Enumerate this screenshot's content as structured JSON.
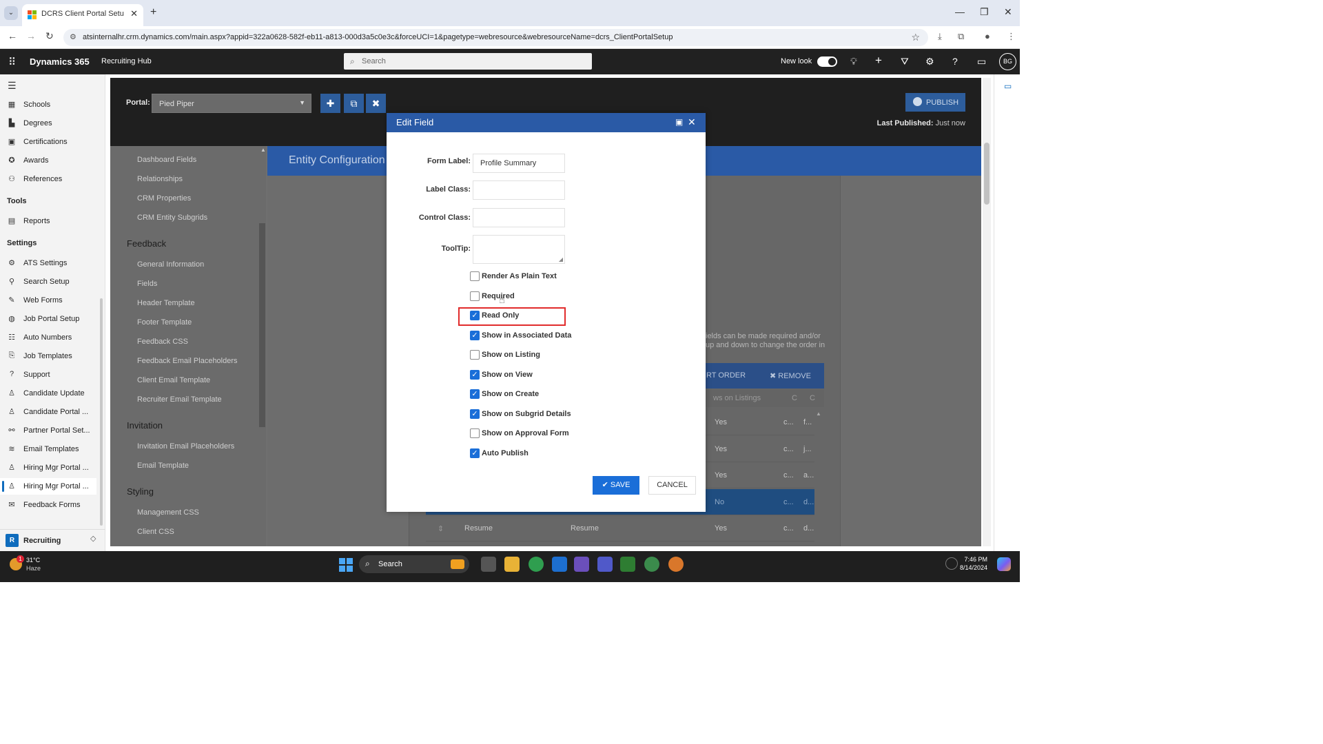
{
  "browser": {
    "tab_title": "DCRS Client Portal Setup Web",
    "url": "atsinternalhr.crm.dynamics.com/main.aspx?appid=322a0628-582f-eb11-a813-000d3a5c0e3c&forceUCI=1&pagetype=webresource&webresourceName=dcrs_ClientPortalSetup"
  },
  "header": {
    "brand": "Dynamics 365",
    "app_name": "Recruiting Hub",
    "search_placeholder": "Search",
    "new_look_label": "New look",
    "new_look_on": true,
    "avatar_initials": "BG"
  },
  "leftnav": {
    "items_top": [
      {
        "label": "Schools",
        "icon": "school-icon"
      },
      {
        "label": "Degrees",
        "icon": "degree-icon"
      },
      {
        "label": "Certifications",
        "icon": "certificate-icon"
      },
      {
        "label": "Awards",
        "icon": "award-icon"
      },
      {
        "label": "References",
        "icon": "references-icon"
      }
    ],
    "tools_heading": "Tools",
    "tools_items": [
      {
        "label": "Reports",
        "icon": "reports-icon"
      }
    ],
    "settings_heading": "Settings",
    "settings_items": [
      {
        "label": "ATS Settings",
        "icon": "gear-icon"
      },
      {
        "label": "Search Setup",
        "icon": "search-setup-icon"
      },
      {
        "label": "Web Forms",
        "icon": "web-forms-icon"
      },
      {
        "label": "Job Portal Setup",
        "icon": "globe-icon"
      },
      {
        "label": "Auto Numbers",
        "icon": "numbered-list-icon"
      },
      {
        "label": "Job Templates",
        "icon": "template-icon"
      },
      {
        "label": "Support",
        "icon": "help-icon"
      },
      {
        "label": "Candidate Update",
        "icon": "person-icon"
      },
      {
        "label": "Candidate Portal ...",
        "icon": "person-icon"
      },
      {
        "label": "Partner Portal Set...",
        "icon": "partner-icon"
      },
      {
        "label": "Email Templates",
        "icon": "stack-icon"
      },
      {
        "label": "Hiring Mgr Portal ...",
        "icon": "person-icon"
      },
      {
        "label": "Hiring Mgr Portal ...",
        "icon": "person-icon"
      },
      {
        "label": "Feedback Forms",
        "icon": "feedback-icon"
      }
    ],
    "active_index": 12,
    "area_letter": "R",
    "area_label": "Recruiting"
  },
  "portal_bar": {
    "portal_label": "Portal:",
    "portal_value": "Pied Piper",
    "publish_label": "PUBLISH",
    "last_published_label": "Last Published:",
    "last_published_value": "Just now"
  },
  "subnav": {
    "group1": [
      "Dashboard Fields",
      "Relationships",
      "CRM Properties",
      "CRM Entity Subgrids"
    ],
    "feedback_heading": "Feedback",
    "feedback_items": [
      "General Information",
      "Fields",
      "Header Template",
      "Footer Template",
      "Feedback CSS",
      "Feedback Email Placeholders",
      "Client Email Template",
      "Recruiter Email Template"
    ],
    "invitation_heading": "Invitation",
    "invitation_items": [
      "Invitation Email Placeholders",
      "Email Template"
    ],
    "styling_heading": "Styling",
    "styling_items": [
      "Management CSS",
      "Client CSS"
    ]
  },
  "content": {
    "entity_config_title": "Entity Configuration",
    "desc_line1": "ields can be made required and/or",
    "desc_line2": "up and down to change the order in",
    "sort_order_label": "RT ORDER",
    "remove_label": "REMOVE",
    "grid_headers": [
      "ws on Listings",
      "C",
      "C"
    ],
    "rows": [
      {
        "a": "",
        "b": "",
        "listing": "Yes",
        "c1": "c...",
        "c2": "f..."
      },
      {
        "a": "",
        "b": "",
        "listing": "Yes",
        "c1": "c...",
        "c2": "j..."
      },
      {
        "a": "",
        "b": "",
        "listing": "Yes",
        "c1": "c...",
        "c2": "a..."
      },
      {
        "a": "",
        "b": "",
        "listing": "No",
        "c1": "c...",
        "c2": "d..."
      },
      {
        "a": "Resume",
        "b": "Resume",
        "listing": "Yes",
        "c1": "c...",
        "c2": "d..."
      }
    ]
  },
  "modal": {
    "title": "Edit Field",
    "form_label_label": "Form Label:",
    "form_label_value": "Profile Summary",
    "label_class_label": "Label Class:",
    "label_class_value": "",
    "control_class_label": "Control Class:",
    "control_class_value": "",
    "tooltip_label": "ToolTip:",
    "tooltip_value": "",
    "checkboxes": [
      {
        "label": "Render As Plain Text",
        "checked": false
      },
      {
        "label": "Required",
        "checked": false
      },
      {
        "label": "Read Only",
        "checked": true
      },
      {
        "label": "Show in Associated Data",
        "checked": true
      },
      {
        "label": "Show on Listing",
        "checked": false
      },
      {
        "label": "Show on View",
        "checked": true
      },
      {
        "label": "Show on Create",
        "checked": true
      },
      {
        "label": "Show on Subgrid Details",
        "checked": true
      },
      {
        "label": "Show on Approval Form",
        "checked": false
      },
      {
        "label": "Auto Publish",
        "checked": true
      }
    ],
    "save_label": "SAVE",
    "cancel_label": "CANCEL"
  },
  "taskbar": {
    "notification_count": "1",
    "temperature": "31°C",
    "condition": "Haze",
    "search_label": "Search",
    "time": "7:46 PM",
    "date": "8/14/2024"
  },
  "colors": {
    "accent": "#2a5aa6",
    "primary_button": "#1a6ed8",
    "highlight_box": "#e12b2b",
    "header_bg": "#212121"
  }
}
